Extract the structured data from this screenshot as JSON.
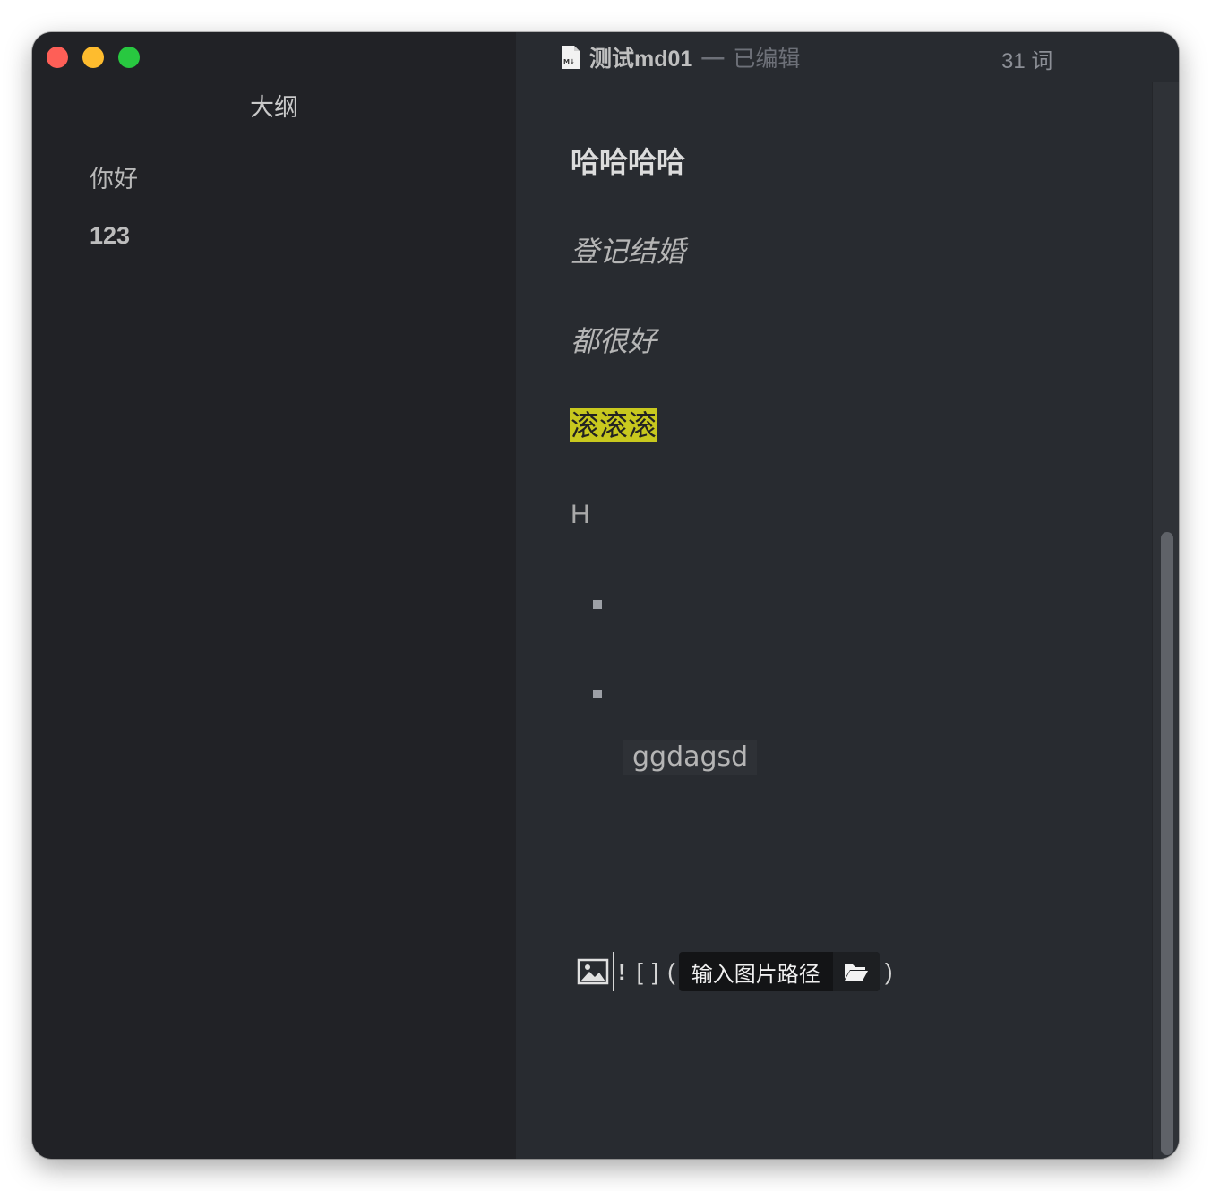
{
  "sidebar": {
    "title": "大纲",
    "items": [
      {
        "label": "你好"
      },
      {
        "label": "123"
      }
    ]
  },
  "titlebar": {
    "doc_title": "测试md01",
    "separator": "—",
    "status": "已编辑",
    "word_count": "31 词"
  },
  "editor": {
    "heading": "哈哈哈哈",
    "italic_1": "登记结婚",
    "italic_2": "都很好",
    "highlight": "滚滚滚",
    "h_text": "H",
    "code_text": "ggdagsd",
    "image_row": {
      "bang": "!",
      "open_bracket": "[",
      "close_bracket": "]",
      "open_paren": "(",
      "path_placeholder": "输入图片路径",
      "close_paren": ")"
    }
  },
  "colors": {
    "sidebar_bg": "#212226",
    "editor_bg": "#282b30",
    "highlight": "#c8c81e",
    "close": "#fe5f57",
    "minimize": "#febc2e",
    "maximize": "#28c840"
  },
  "icons": [
    "markdown-file-icon",
    "image-icon",
    "folder-open-icon"
  ]
}
